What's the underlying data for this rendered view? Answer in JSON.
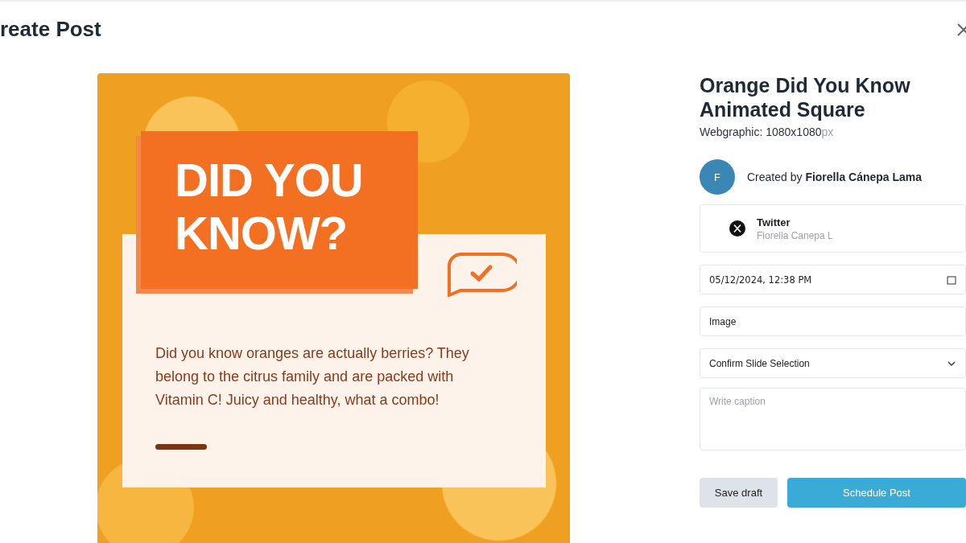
{
  "modal": {
    "title": "reate Post"
  },
  "graphic": {
    "headline_line_1": "DID YOU",
    "headline_line_2": "KNOW?",
    "body": "Did you know oranges are actually berries? They belong to the citrus family and are packed with Vitamin C! Juicy and healthy, what a combo!"
  },
  "details": {
    "name": "Orange Did You Know Animated Square",
    "type_label": "Webgraphic: 1080x1080",
    "unit": "px"
  },
  "creator": {
    "initial": "F",
    "prefix": "Created by",
    "name": "Fiorella Cánepa Lama"
  },
  "account": {
    "network": "Twitter",
    "handle": "Fiorella Canepa L"
  },
  "schedule": {
    "value": "05/12/2024, 12:38 PM"
  },
  "media_type": {
    "value": "Image"
  },
  "slide_select": {
    "value": "Confirm Slide Selection"
  },
  "caption": {
    "placeholder": "Write caption"
  },
  "buttons": [
    {
      "kind": "secondary",
      "label": "Save draft"
    },
    {
      "kind": "primary",
      "label": "Schedule Post"
    }
  ]
}
